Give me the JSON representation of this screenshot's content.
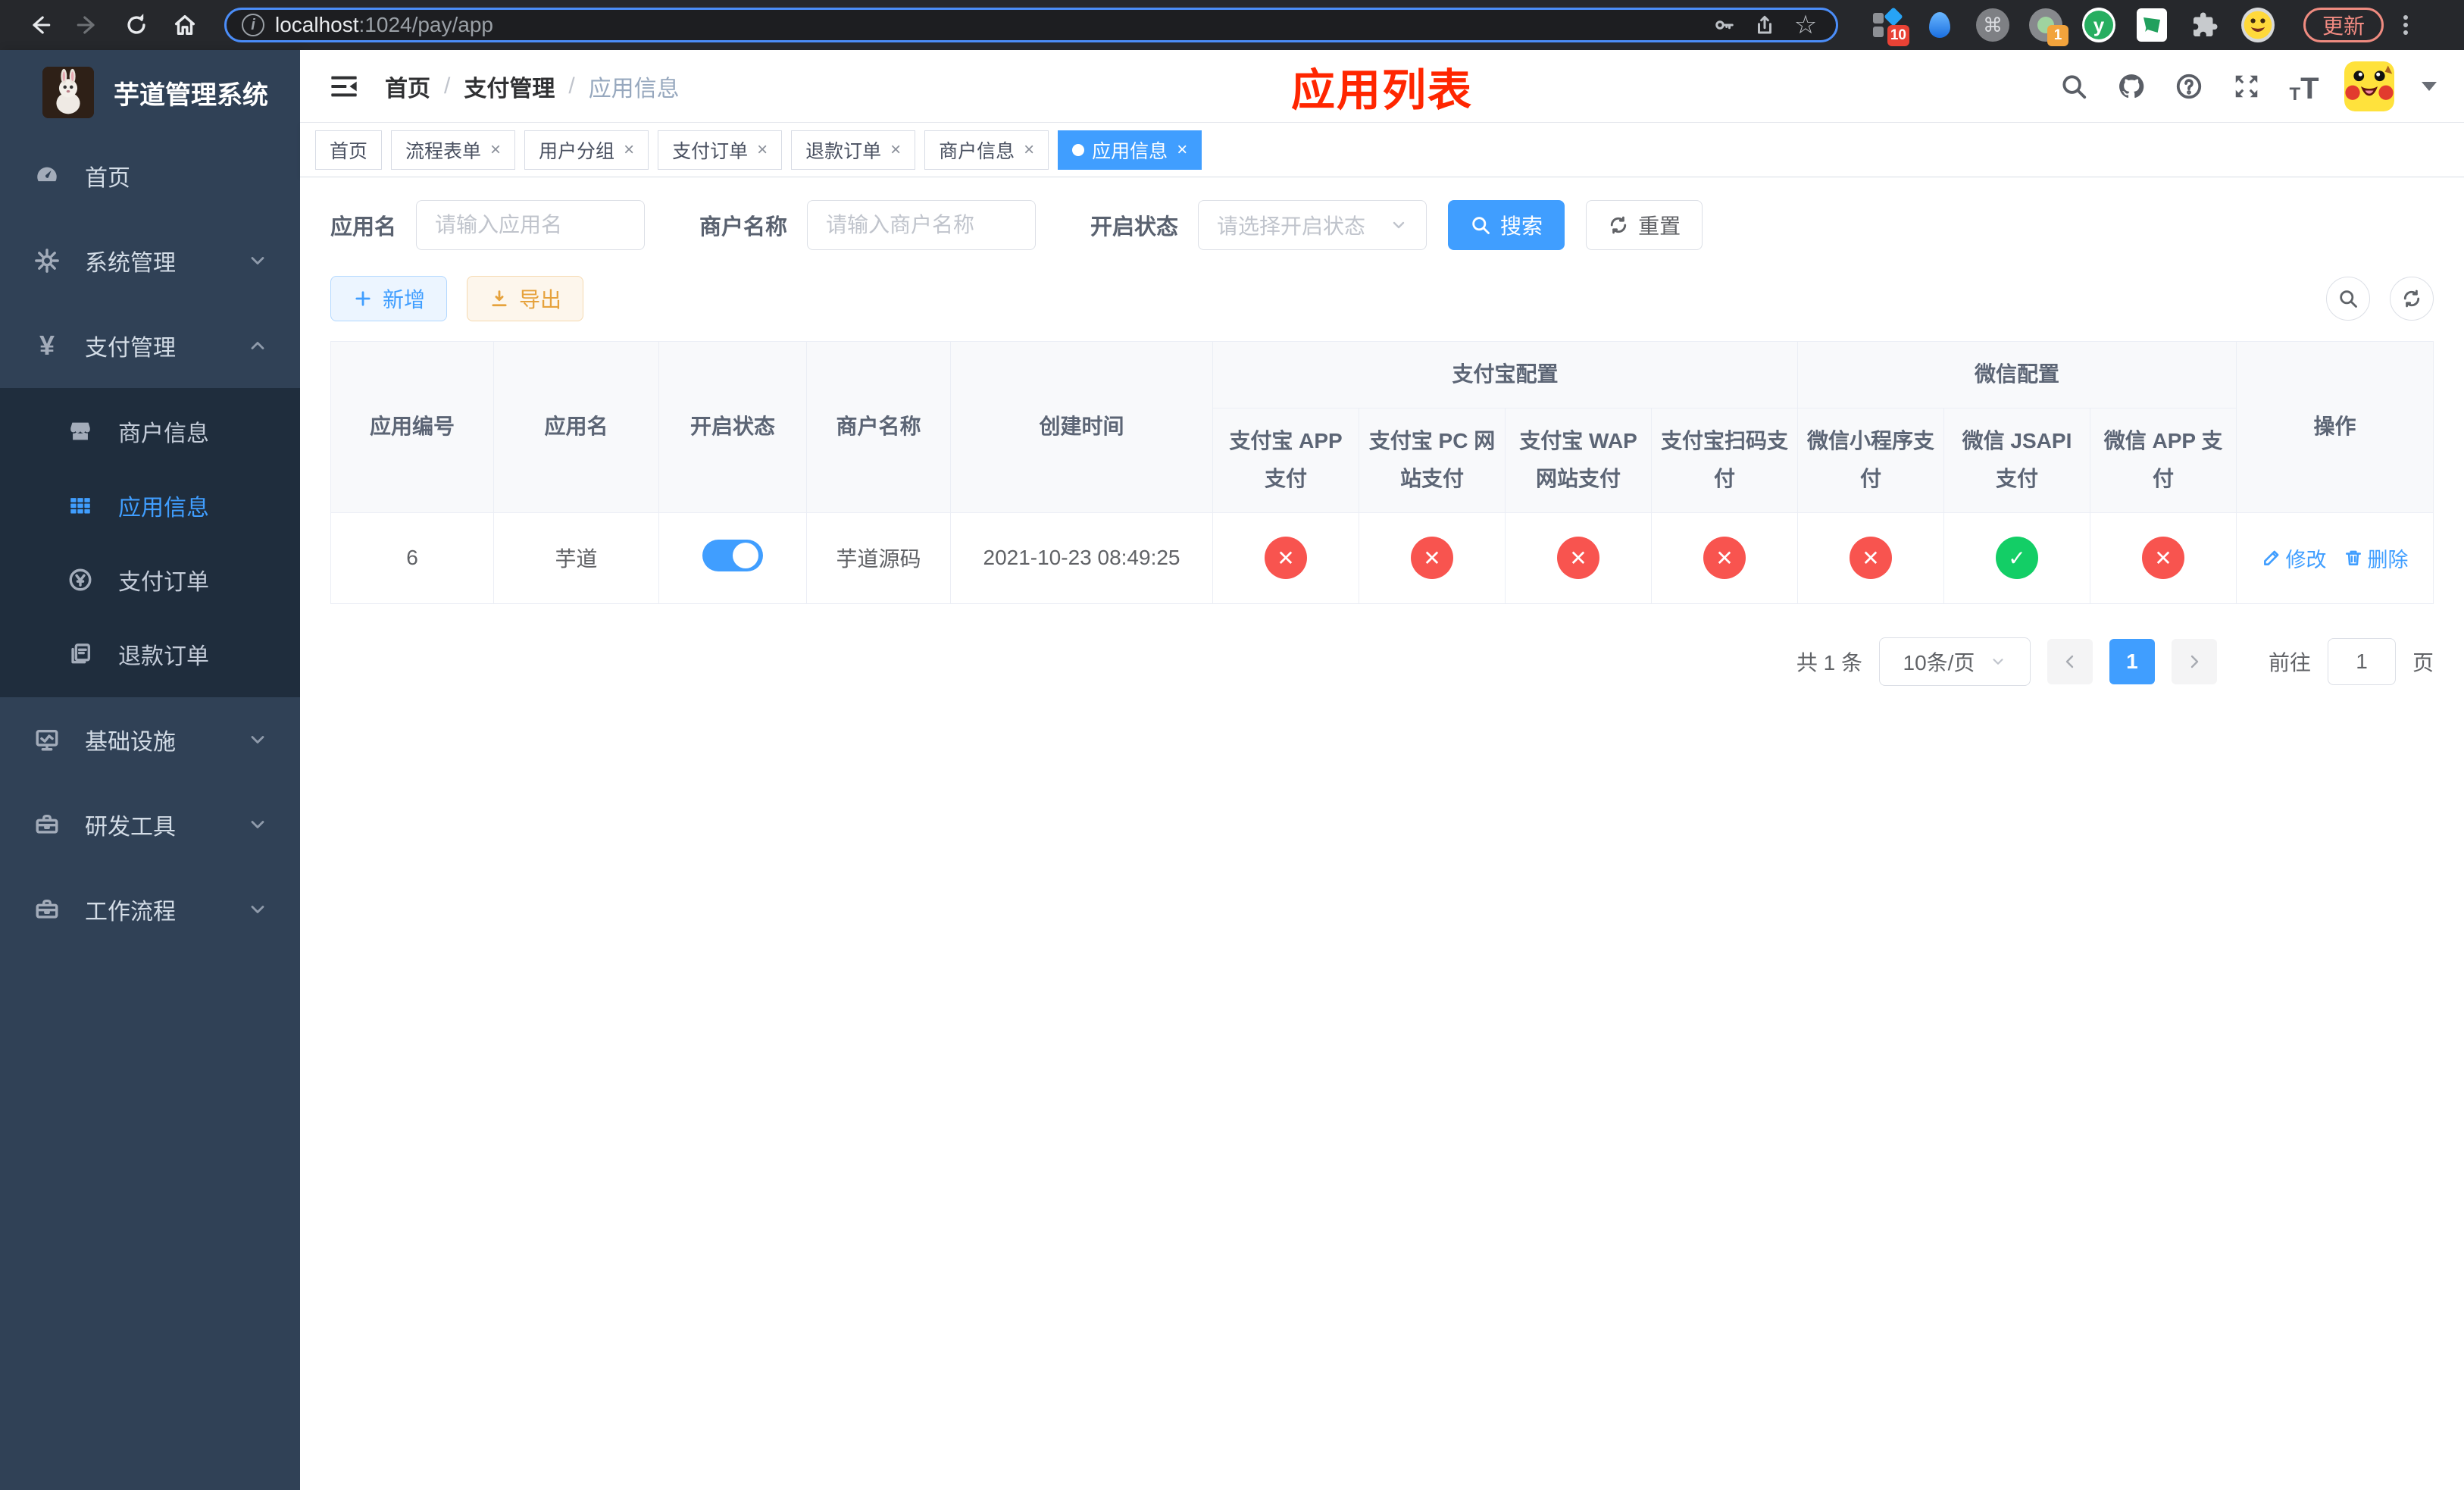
{
  "colors": {
    "accent": "#409eff",
    "success": "#13ce66",
    "danger": "#f56c6c",
    "warning": "#e6a23c",
    "title_red": "#ff2600",
    "sidebar_bg": "#304156",
    "submenu_bg": "#1f2d3d"
  },
  "browser": {
    "url": {
      "host": "localhost",
      "path": ":1024/pay/app"
    },
    "update_label": "更新",
    "extension_badges": {
      "first": "10",
      "second": "1"
    },
    "green_ext_letter": "y",
    "command_glyph": "⌘",
    "star_glyph": "☆"
  },
  "sidebar": {
    "title": "芋道管理系统",
    "items": [
      {
        "label": "首页"
      },
      {
        "label": "系统管理"
      },
      {
        "label": "支付管理"
      },
      {
        "label": "基础设施"
      },
      {
        "label": "研发工具"
      },
      {
        "label": "工作流程"
      }
    ],
    "submenu": [
      {
        "label": "商户信息"
      },
      {
        "label": "应用信息"
      },
      {
        "label": "支付订单"
      },
      {
        "label": "退款订单"
      }
    ],
    "yen_glyph": "¥"
  },
  "navbar": {
    "breadcrumb": [
      "首页",
      "支付管理",
      "应用信息"
    ],
    "separator": "/",
    "overlay_title": "应用列表"
  },
  "tabs": [
    {
      "label": "首页"
    },
    {
      "label": "流程表单"
    },
    {
      "label": "用户分组"
    },
    {
      "label": "支付订单"
    },
    {
      "label": "退款订单"
    },
    {
      "label": "商户信息"
    },
    {
      "label": "应用信息"
    }
  ],
  "tab_close_glyph": "×",
  "filters": {
    "app_name_label": "应用名",
    "app_name_placeholder": "请输入应用名",
    "merchant_label": "商户名称",
    "merchant_placeholder": "请输入商户名称",
    "status_label": "开启状态",
    "status_placeholder": "请选择开启状态",
    "search_label": "搜索",
    "reset_label": "重置"
  },
  "toolbar": {
    "add_label": "新增",
    "export_label": "导出"
  },
  "table": {
    "group_headers": {
      "alipay": "支付宝配置",
      "wechat": "微信配置"
    },
    "columns": {
      "app_id": "应用编号",
      "app_name": "应用名",
      "enabled": "开启状态",
      "merchant": "商户名称",
      "created": "创建时间",
      "alipay_app": "支付宝 APP 支付",
      "alipay_pc": "支付宝 PC 网站支付",
      "alipay_wap": "支付宝 WAP 网站支付",
      "alipay_qr": "支付宝扫码支付",
      "wx_mini": "微信小程序支付",
      "wx_jsapi": "微信 JSAPI 支付",
      "wx_app": "微信 APP 支付",
      "actions": "操作"
    },
    "glyphs": {
      "ok": "✓",
      "fail": "✕"
    },
    "row": {
      "app_id": "6",
      "app_name": "芋道",
      "enabled": true,
      "merchant": "芋道源码",
      "created": "2021-10-23 08:49:25",
      "statuses": [
        false,
        false,
        false,
        false,
        false,
        true,
        false
      ],
      "edit_label": "修改",
      "delete_label": "删除"
    }
  },
  "pagination": {
    "total": "共 1 条",
    "page_size": "10条/页",
    "page": "1",
    "goto_label": "前往",
    "goto_value": "1",
    "unit_label": "页"
  }
}
